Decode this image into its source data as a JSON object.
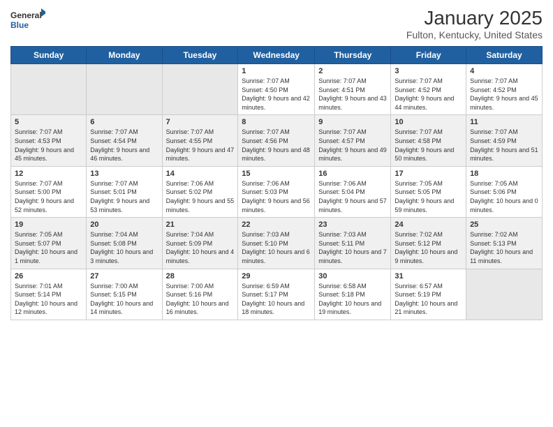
{
  "logo": {
    "general": "General",
    "blue": "Blue"
  },
  "title": {
    "month": "January 2025",
    "location": "Fulton, Kentucky, United States"
  },
  "weekdays": [
    "Sunday",
    "Monday",
    "Tuesday",
    "Wednesday",
    "Thursday",
    "Friday",
    "Saturday"
  ],
  "weeks": [
    [
      {
        "day": "",
        "info": ""
      },
      {
        "day": "",
        "info": ""
      },
      {
        "day": "",
        "info": ""
      },
      {
        "day": "1",
        "info": "Sunrise: 7:07 AM\nSunset: 4:50 PM\nDaylight: 9 hours and 42 minutes."
      },
      {
        "day": "2",
        "info": "Sunrise: 7:07 AM\nSunset: 4:51 PM\nDaylight: 9 hours and 43 minutes."
      },
      {
        "day": "3",
        "info": "Sunrise: 7:07 AM\nSunset: 4:52 PM\nDaylight: 9 hours and 44 minutes."
      },
      {
        "day": "4",
        "info": "Sunrise: 7:07 AM\nSunset: 4:52 PM\nDaylight: 9 hours and 45 minutes."
      }
    ],
    [
      {
        "day": "5",
        "info": "Sunrise: 7:07 AM\nSunset: 4:53 PM\nDaylight: 9 hours and 45 minutes."
      },
      {
        "day": "6",
        "info": "Sunrise: 7:07 AM\nSunset: 4:54 PM\nDaylight: 9 hours and 46 minutes."
      },
      {
        "day": "7",
        "info": "Sunrise: 7:07 AM\nSunset: 4:55 PM\nDaylight: 9 hours and 47 minutes."
      },
      {
        "day": "8",
        "info": "Sunrise: 7:07 AM\nSunset: 4:56 PM\nDaylight: 9 hours and 48 minutes."
      },
      {
        "day": "9",
        "info": "Sunrise: 7:07 AM\nSunset: 4:57 PM\nDaylight: 9 hours and 49 minutes."
      },
      {
        "day": "10",
        "info": "Sunrise: 7:07 AM\nSunset: 4:58 PM\nDaylight: 9 hours and 50 minutes."
      },
      {
        "day": "11",
        "info": "Sunrise: 7:07 AM\nSunset: 4:59 PM\nDaylight: 9 hours and 51 minutes."
      }
    ],
    [
      {
        "day": "12",
        "info": "Sunrise: 7:07 AM\nSunset: 5:00 PM\nDaylight: 9 hours and 52 minutes."
      },
      {
        "day": "13",
        "info": "Sunrise: 7:07 AM\nSunset: 5:01 PM\nDaylight: 9 hours and 53 minutes."
      },
      {
        "day": "14",
        "info": "Sunrise: 7:06 AM\nSunset: 5:02 PM\nDaylight: 9 hours and 55 minutes."
      },
      {
        "day": "15",
        "info": "Sunrise: 7:06 AM\nSunset: 5:03 PM\nDaylight: 9 hours and 56 minutes."
      },
      {
        "day": "16",
        "info": "Sunrise: 7:06 AM\nSunset: 5:04 PM\nDaylight: 9 hours and 57 minutes."
      },
      {
        "day": "17",
        "info": "Sunrise: 7:05 AM\nSunset: 5:05 PM\nDaylight: 9 hours and 59 minutes."
      },
      {
        "day": "18",
        "info": "Sunrise: 7:05 AM\nSunset: 5:06 PM\nDaylight: 10 hours and 0 minutes."
      }
    ],
    [
      {
        "day": "19",
        "info": "Sunrise: 7:05 AM\nSunset: 5:07 PM\nDaylight: 10 hours and 1 minute."
      },
      {
        "day": "20",
        "info": "Sunrise: 7:04 AM\nSunset: 5:08 PM\nDaylight: 10 hours and 3 minutes."
      },
      {
        "day": "21",
        "info": "Sunrise: 7:04 AM\nSunset: 5:09 PM\nDaylight: 10 hours and 4 minutes."
      },
      {
        "day": "22",
        "info": "Sunrise: 7:03 AM\nSunset: 5:10 PM\nDaylight: 10 hours and 6 minutes."
      },
      {
        "day": "23",
        "info": "Sunrise: 7:03 AM\nSunset: 5:11 PM\nDaylight: 10 hours and 7 minutes."
      },
      {
        "day": "24",
        "info": "Sunrise: 7:02 AM\nSunset: 5:12 PM\nDaylight: 10 hours and 9 minutes."
      },
      {
        "day": "25",
        "info": "Sunrise: 7:02 AM\nSunset: 5:13 PM\nDaylight: 10 hours and 11 minutes."
      }
    ],
    [
      {
        "day": "26",
        "info": "Sunrise: 7:01 AM\nSunset: 5:14 PM\nDaylight: 10 hours and 12 minutes."
      },
      {
        "day": "27",
        "info": "Sunrise: 7:00 AM\nSunset: 5:15 PM\nDaylight: 10 hours and 14 minutes."
      },
      {
        "day": "28",
        "info": "Sunrise: 7:00 AM\nSunset: 5:16 PM\nDaylight: 10 hours and 16 minutes."
      },
      {
        "day": "29",
        "info": "Sunrise: 6:59 AM\nSunset: 5:17 PM\nDaylight: 10 hours and 18 minutes."
      },
      {
        "day": "30",
        "info": "Sunrise: 6:58 AM\nSunset: 5:18 PM\nDaylight: 10 hours and 19 minutes."
      },
      {
        "day": "31",
        "info": "Sunrise: 6:57 AM\nSunset: 5:19 PM\nDaylight: 10 hours and 21 minutes."
      },
      {
        "day": "",
        "info": ""
      }
    ]
  ]
}
